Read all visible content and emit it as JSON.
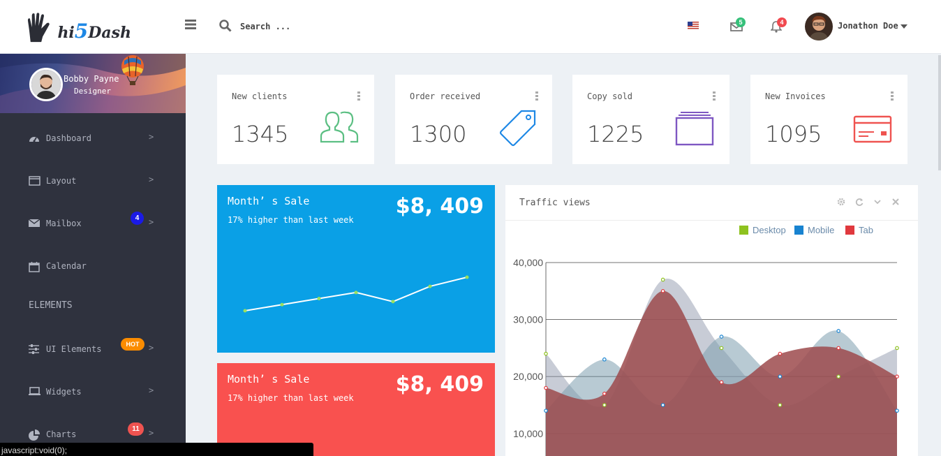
{
  "app": {
    "logo_brand": "hi5Dash",
    "logo_prefix": "hi",
    "logo_five": "5",
    "logo_suffix": "Dash"
  },
  "header": {
    "search_placeholder": "Search ...",
    "mail_count": "5",
    "notification_count": "4",
    "user_name": "Jonathon Doe",
    "colors": {
      "mail_badge": "#36c07a",
      "notif_badge": "#f1494f"
    }
  },
  "sidebar": {
    "profile": {
      "name": "Bobby Payne",
      "role": "Designer"
    },
    "items": [
      {
        "label": "Dashboard",
        "icon": "dashboard-icon",
        "chevron": ">"
      },
      {
        "label": "Layout",
        "icon": "layout-icon",
        "chevron": ">"
      },
      {
        "label": "Mailbox",
        "icon": "envelope-icon",
        "badge": "4",
        "chevron": ">"
      },
      {
        "label": "Calendar",
        "icon": "calendar-icon"
      }
    ],
    "section_title": "ELEMENTS",
    "elements": [
      {
        "label": "UI Elements",
        "icon": "sliders-icon",
        "badge": "HOT",
        "chevron": ">"
      },
      {
        "label": "Widgets",
        "icon": "laptop-icon",
        "chevron": ">"
      },
      {
        "label": "Charts",
        "icon": "pie-chart-icon",
        "badge": "11",
        "chevron": ">"
      }
    ]
  },
  "stats": [
    {
      "title": "New clients",
      "value": "1345",
      "icon": "users-icon",
      "color": "#5cbf83"
    },
    {
      "title": "Order received",
      "value": "1300",
      "icon": "tag-icon",
      "color": "#1e88e5"
    },
    {
      "title": "Copy sold",
      "value": "1225",
      "icon": "stack-icon",
      "color": "#7e57c2"
    },
    {
      "title": "New Invoices",
      "value": "1095",
      "icon": "credit-card-icon",
      "color": "#ef5350"
    }
  ],
  "sales": [
    {
      "title": "Month’ s Sale",
      "subtitle": "17% higher than last week",
      "amount": "$8, 409",
      "color": "#0aa0e6"
    },
    {
      "title": "Month’ s Sale",
      "subtitle": "17% higher than last week",
      "amount": "$8, 409",
      "color": "#f9514f"
    }
  ],
  "sparkline": {
    "values": [
      1,
      2,
      3,
      4,
      2.5,
      5,
      6.5
    ]
  },
  "traffic": {
    "title": "Traffic views",
    "tools": [
      "gear-icon",
      "refresh-icon",
      "chevron-down-icon",
      "close-icon"
    ]
  },
  "chart_data": {
    "type": "area",
    "x": [
      0,
      1,
      2,
      3,
      4,
      5,
      6
    ],
    "ylim": [
      0,
      40000
    ],
    "yticks": [
      "10,000",
      "20,000",
      "30,000",
      "40,000"
    ],
    "series": [
      {
        "name": "Desktop",
        "color": "#8ec21f",
        "values": [
          24000,
          15000,
          37000,
          25000,
          15000,
          20000,
          25000
        ]
      },
      {
        "name": "Mobile",
        "color": "#1883d0",
        "values": [
          14000,
          23000,
          15000,
          27000,
          20000,
          28000,
          14000
        ]
      },
      {
        "name": "Tab",
        "color": "#e0393e",
        "values": [
          18000,
          17000,
          35000,
          19000,
          24000,
          25000,
          20000
        ]
      }
    ]
  },
  "statusbar": {
    "text": "javascript:void(0);"
  }
}
